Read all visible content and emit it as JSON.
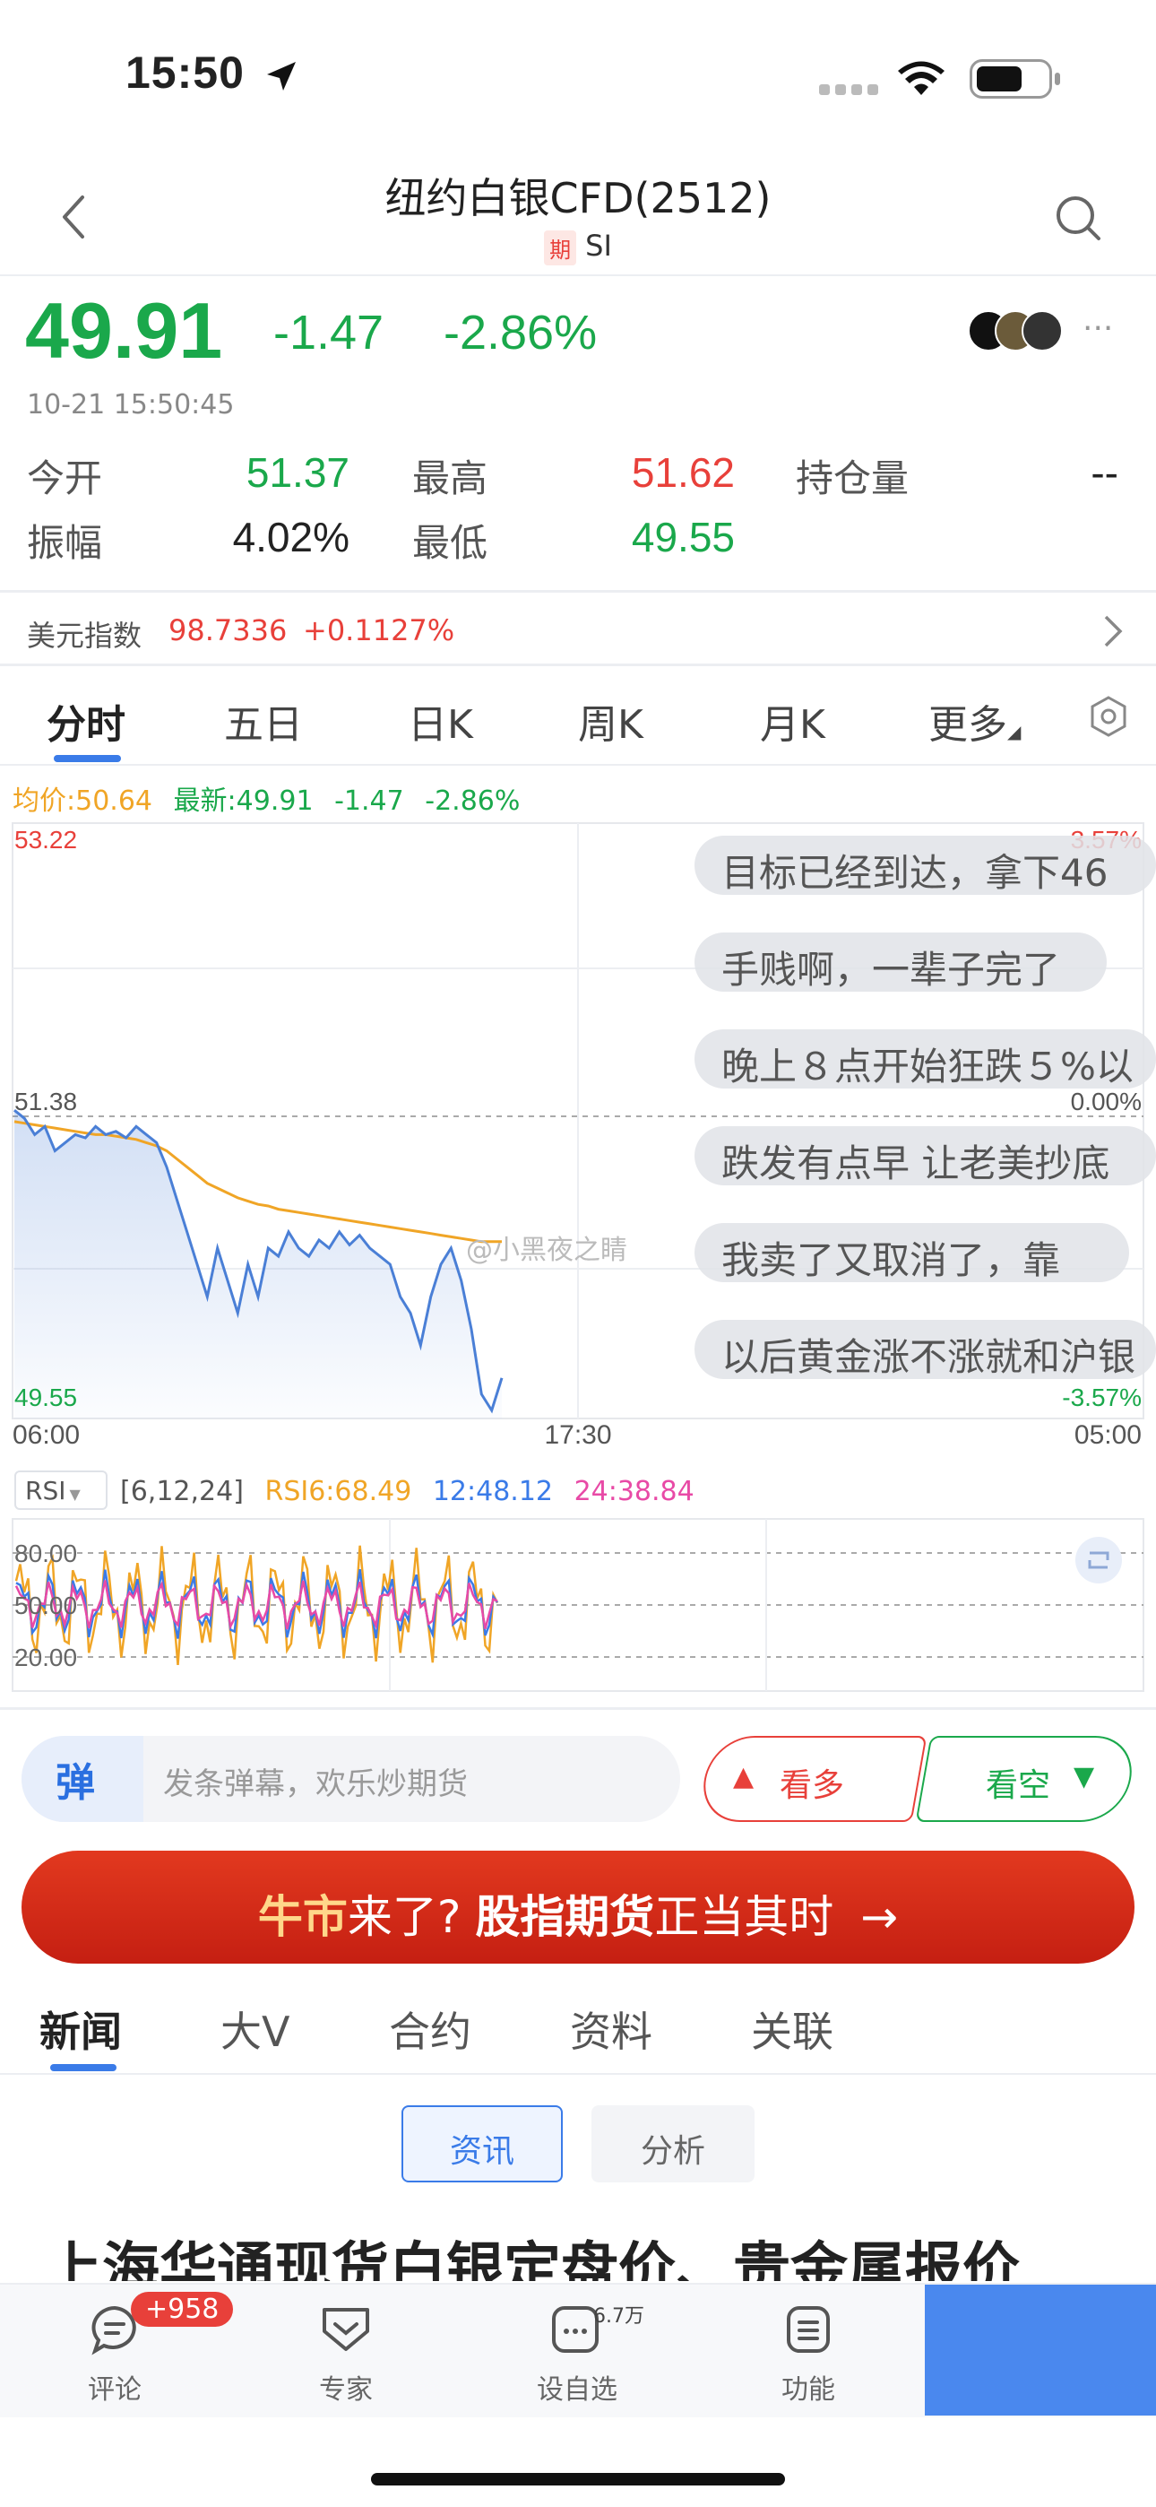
{
  "status_bar": {
    "time": "15:50"
  },
  "header": {
    "title": "纽约白银CFD(2512)",
    "tag": "期",
    "symbol": "SI"
  },
  "quote": {
    "price": "49.91",
    "change": "-1.47",
    "change_pct": "-2.86%",
    "time": "10-21 15:50:45",
    "open_label": "今开",
    "open": "51.37",
    "high_label": "最高",
    "high": "51.62",
    "oi_label": "持仓量",
    "oi": "--",
    "amp_label": "振幅",
    "amp": "4.02%",
    "low_label": "最低",
    "low": "49.55"
  },
  "dxy": {
    "label": "美元指数",
    "value": "98.7336",
    "change": "+0.1127%"
  },
  "kline_tabs": [
    "分时",
    "五日",
    "日K",
    "周K",
    "月K",
    "更多"
  ],
  "chart_info": {
    "avg": "均价:50.64",
    "latest": "最新:49.91",
    "chg": "-1.47",
    "pct": "-2.86%"
  },
  "chart_labels": {
    "top_price": "53.22",
    "bottom_price": "49.55",
    "mid_price": "51.38",
    "top_pct": "3.57%",
    "mid_pct": "0.00%",
    "bottom_pct": "-3.57%",
    "x_start": "06:00",
    "x_mid": "17:30",
    "x_end": "05:00",
    "watermark": "@小黑夜之睛"
  },
  "chart_data": {
    "type": "line",
    "x_labels": [
      "06:00",
      "17:30",
      "05:00"
    ],
    "ylim": [
      49.55,
      53.22
    ],
    "series": [
      {
        "name": "最新",
        "values": [
          51.45,
          51.4,
          51.3,
          51.35,
          51.2,
          51.25,
          51.3,
          51.28,
          51.35,
          51.3,
          51.32,
          51.28,
          51.35,
          51.3,
          51.25,
          51.1,
          50.9,
          50.7,
          50.5,
          50.3,
          50.6,
          50.4,
          50.2,
          50.5,
          50.3,
          50.6,
          50.55,
          50.7,
          50.6,
          50.55,
          50.65,
          50.6,
          50.7,
          50.62,
          50.68,
          50.6,
          50.55,
          50.5,
          50.3,
          50.2,
          50.0,
          50.3,
          50.5,
          50.6,
          50.4,
          50.1,
          49.7,
          49.6,
          49.8
        ]
      },
      {
        "name": "均价",
        "values": [
          51.38,
          51.37,
          51.36,
          51.35,
          51.34,
          51.33,
          51.32,
          51.31,
          51.3,
          51.3,
          51.29,
          51.28,
          51.27,
          51.25,
          51.23,
          51.2,
          51.15,
          51.1,
          51.05,
          51.0,
          50.97,
          50.94,
          50.91,
          50.89,
          50.87,
          50.86,
          50.84,
          50.83,
          50.82,
          50.81,
          50.8,
          50.79,
          50.78,
          50.77,
          50.76,
          50.75,
          50.74,
          50.73,
          50.72,
          50.71,
          50.7,
          50.69,
          50.68,
          50.67,
          50.66,
          50.65,
          50.64,
          50.64,
          50.64
        ]
      }
    ]
  },
  "danmu": [
    "目标已经到达，拿下46",
    "手贱啊，一辈子完了",
    "晚上８点开始狂跌５%以",
    "跌发有点早 让老美抄底",
    "我卖了又取消了，靠",
    "以后黄金涨不涨就和沪银"
  ],
  "rsi": {
    "selector": "RSI",
    "params": "[6,12,24]",
    "rsi6": "RSI6:68.49",
    "rsi12": "12:48.12",
    "rsi24": "24:38.84",
    "levels": [
      "80.00",
      "50.00",
      "20.00"
    ]
  },
  "danmu_input": {
    "badge": "弹",
    "placeholder": "发条弹幕，欢乐炒期货"
  },
  "vote": {
    "bull": "看多",
    "bear": "看空"
  },
  "banner": {
    "part1": "牛市",
    "part2": "来了?",
    "part3": "股指期货",
    "part4": "正当其时",
    "arrow": "→"
  },
  "news_tabs": [
    "新闻",
    "大V",
    "合约",
    "资料",
    "关联"
  ],
  "news_pills": {
    "news": "资讯",
    "analysis": "分析"
  },
  "headline": "上海华通现货白银定盘价、贵金属报价",
  "bottom_bar": {
    "comment": "评论",
    "comment_badge": "+958",
    "expert": "专家",
    "watch": "设自选",
    "watch_count": "6.7万",
    "functions": "功能"
  },
  "colors": {
    "up": "#e8403a",
    "down": "#1aa84b",
    "accent": "#3a7be8",
    "avg_line": "#f0a526"
  }
}
